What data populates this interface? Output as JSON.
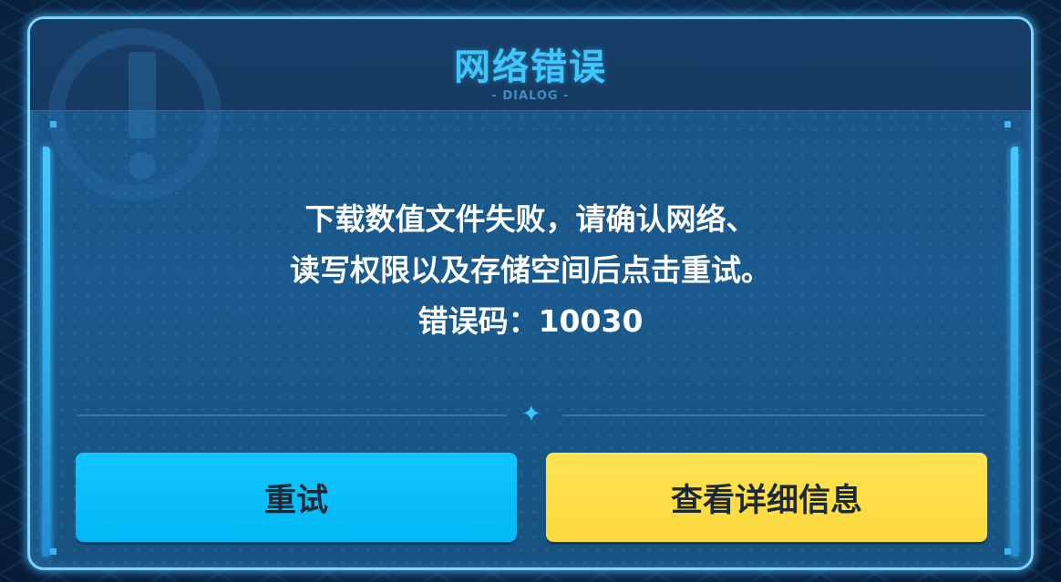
{
  "dialog": {
    "title": "网络错误",
    "subtitle": "- DIALOG -",
    "message_lines": [
      "下载数值文件失败，请确认网络、",
      "读写权限以及存储空间后点击重试。",
      "错误码：10030"
    ],
    "buttons": {
      "retry": "重试",
      "details": "查看详细信息"
    }
  },
  "colors": {
    "title": "#3fc6ff",
    "retry_button": "#00b8f5",
    "details_button": "#fcd93e",
    "frame_glow": "#7fd3ff"
  },
  "icons": {
    "divider": "four-point-star-icon",
    "background": "warning-exclamation-icon"
  }
}
